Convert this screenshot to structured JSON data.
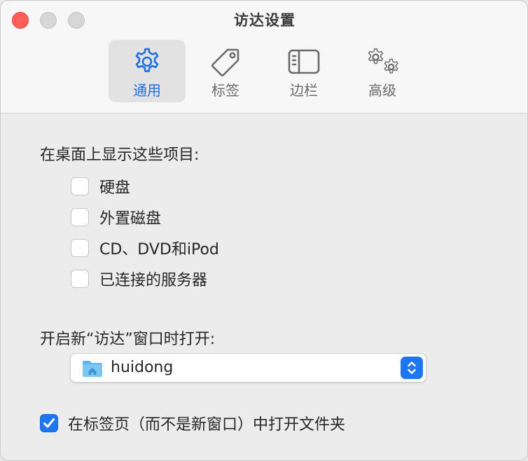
{
  "window": {
    "title": "访达设置"
  },
  "toolbar": {
    "tabs": [
      {
        "label": "通用",
        "icon": "gear-icon",
        "active": true
      },
      {
        "label": "标签",
        "icon": "tag-icon",
        "active": false
      },
      {
        "label": "边栏",
        "icon": "sidebar-icon",
        "active": false
      },
      {
        "label": "高级",
        "icon": "gears-icon",
        "active": false
      }
    ]
  },
  "desktop": {
    "heading": "在桌面上显示这些项目:",
    "items": [
      {
        "label": "硬盘",
        "checked": false
      },
      {
        "label": "外置磁盘",
        "checked": false
      },
      {
        "label": "CD、DVD和iPod",
        "checked": false
      },
      {
        "label": "已连接的服务器",
        "checked": false
      }
    ]
  },
  "new_window": {
    "heading": "开启新“访达”窗口时打开:",
    "selected": "huidong",
    "icon": "home-folder-icon"
  },
  "tabs_option": {
    "label": "在标签页（而不是新窗口）中打开文件夹",
    "checked": true
  },
  "colors": {
    "accent": "#1f76f3",
    "close": "#fd5f57"
  }
}
